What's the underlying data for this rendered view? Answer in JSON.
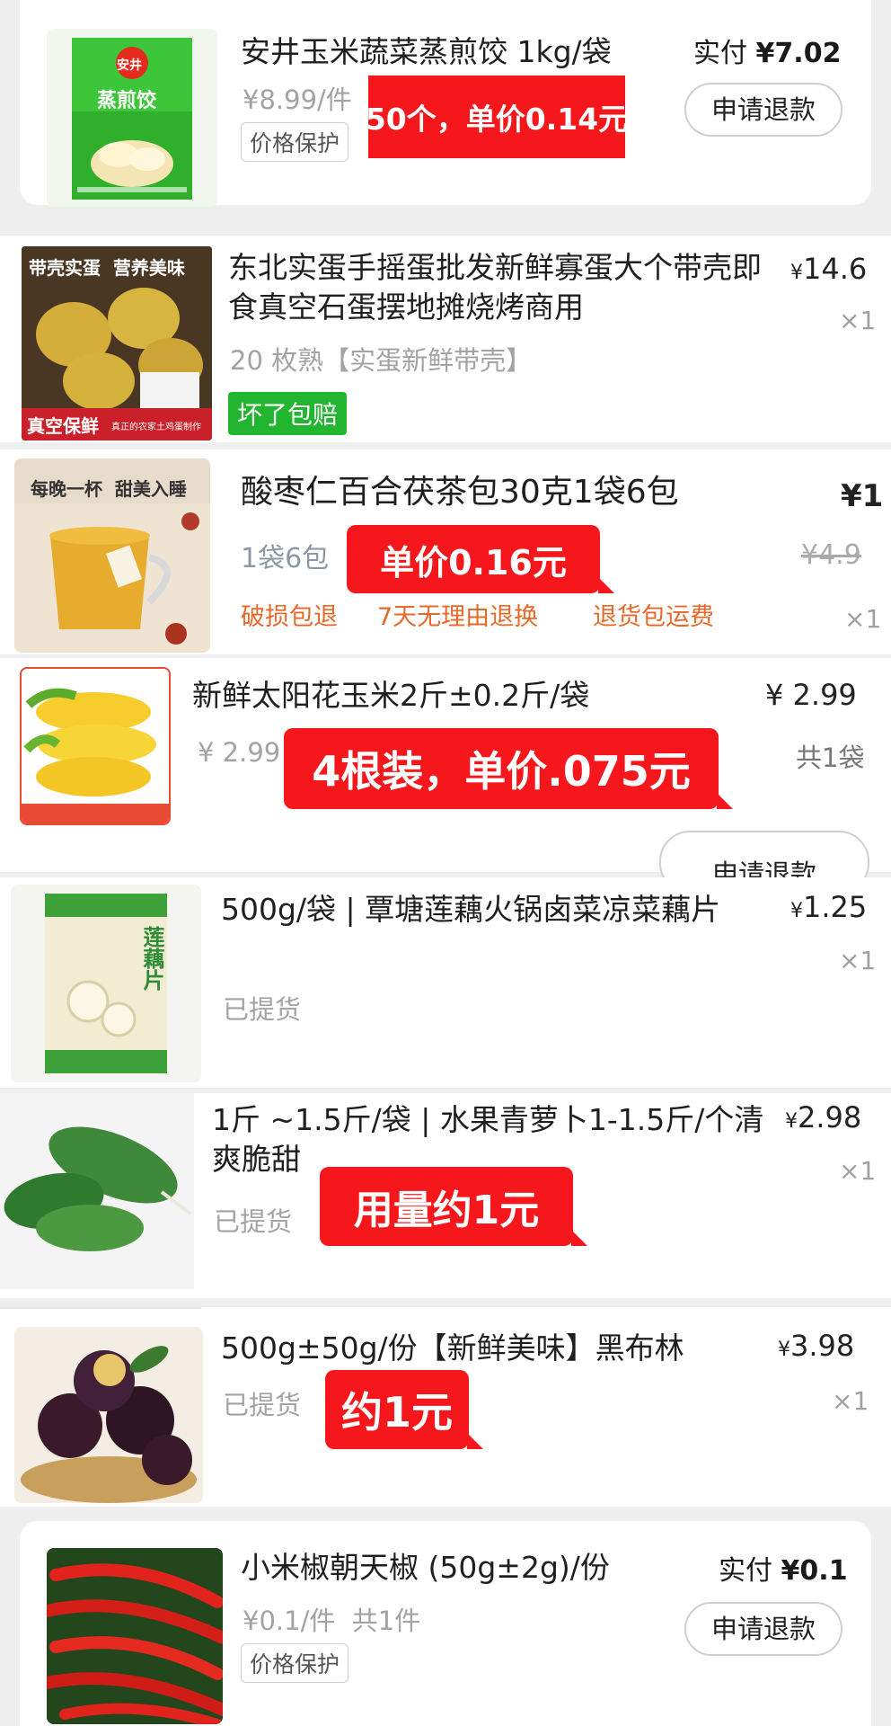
{
  "items": [
    {
      "title": "安井玉米蔬菜蒸煎饺 1kg/袋",
      "unit_price": "¥8.99/件",
      "paid_label": "实付",
      "paid_amount": "¥7.02",
      "tag": "价格保护",
      "button": "申请退款",
      "note": "50个，单价0.14元",
      "thumb_text": "蒸煎饺",
      "thumb_brand": "安井"
    },
    {
      "title": "东北实蛋手摇蛋批发新鲜寡蛋大个带壳即食真空石蛋摆地摊烧烤商用",
      "spec": "20 枚熟【实蛋新鲜带壳】",
      "price_yen": "¥",
      "price": "14.6",
      "qty": "×1",
      "badge": "坏了包赔",
      "thumb_top": "带壳实蛋  营养美味",
      "thumb_bottom": "真空保鲜",
      "thumb_bottom2": "真正的农家土鸡蛋制作"
    },
    {
      "title": "酸枣仁百合茯茶包30克1袋6包",
      "spec": "1袋6包",
      "price": "¥1",
      "original_price": "¥4.9",
      "qty": "×1",
      "services": [
        "破损包退",
        "7天无理由退换",
        "退货包运费"
      ],
      "note": "单价0.16元",
      "thumb_text": "每晚一杯  甜美入睡"
    },
    {
      "title": "新鲜太阳花玉米2斤±0.2斤/袋",
      "price": "¥ 2.99",
      "unit_price": "¥ 2.99",
      "qty": "共1袋",
      "button": "申请退款",
      "note": "4根装，单价.075元"
    },
    {
      "title": "500g/袋 | 覃塘莲藕火锅卤菜凉菜藕片",
      "status": "已提货",
      "price_yen": "¥",
      "price": "1.25",
      "qty": "×1",
      "thumb_text": "莲藕片"
    },
    {
      "title": "1斤 ~1.5斤/袋 | 水果青萝卜1-1.5斤/个清爽脆甜",
      "status": "已提货",
      "price_yen": "¥",
      "price": "2.98",
      "qty": "×1",
      "note": "用量约1元"
    },
    {
      "title": "500g±50g/份【新鲜美味】黑布林",
      "status": "已提货",
      "price_yen": "¥",
      "price": "3.98",
      "qty": "×1",
      "note": "约1元"
    },
    {
      "title": "小米椒朝天椒 (50g±2g)/份",
      "unit_price": "¥0.1/件  共1件",
      "paid_label": "实付",
      "paid_amount": "¥0.1",
      "tag": "价格保护",
      "button": "申请退款"
    }
  ],
  "colors": {
    "accent_red": "#f5171b",
    "green_badge": "#21b530",
    "service_orange": "#e7692a"
  }
}
